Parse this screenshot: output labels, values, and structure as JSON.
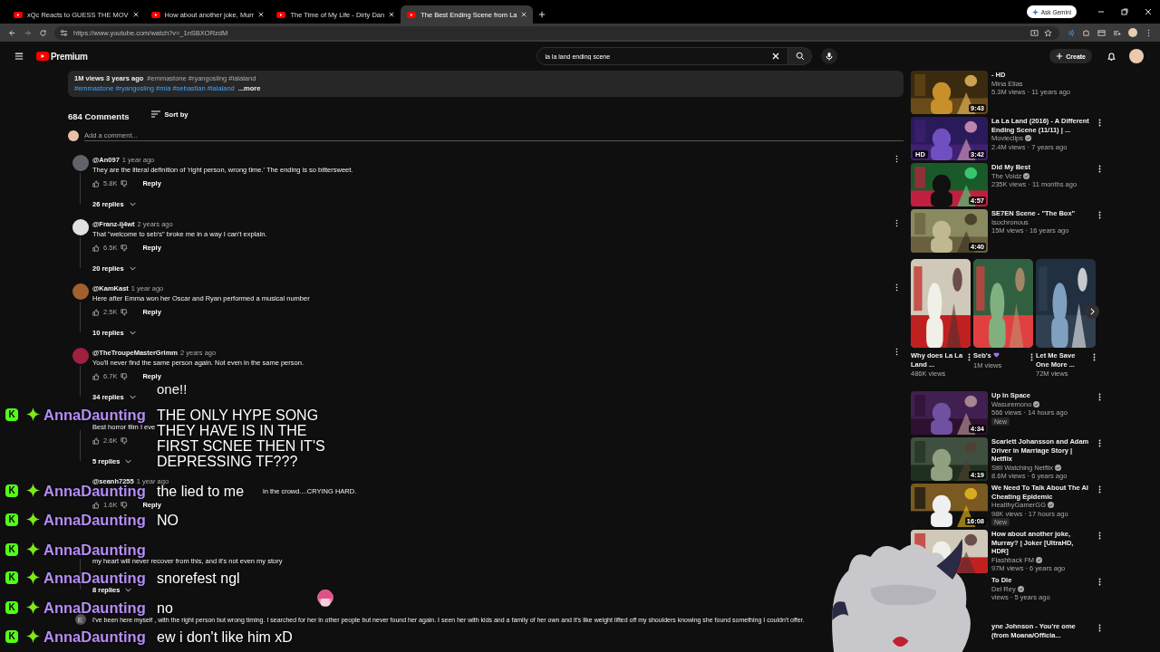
{
  "browser": {
    "tabs": [
      {
        "title": "xQc Reacts to GUESS THE MOV",
        "selected": false
      },
      {
        "title": "How about another joke, Murr",
        "selected": false
      },
      {
        "title": "The Time of My Life - Dirty Dan",
        "selected": false
      },
      {
        "title": "The Best Ending Scene from La",
        "selected": true
      }
    ],
    "ask_button": "Ask Gemini",
    "url": "https://www.youtube.com/watch?v=_1nSBXORzdM"
  },
  "header": {
    "logo": "Premium",
    "search": {
      "value": "la la land ending scene"
    },
    "create": "Create"
  },
  "description": {
    "stats": "1M views  3 years ago",
    "tags_top": "#emmastone #ryangosling #lalaland",
    "tags": "#emmastone #ryangosling #mia #sebastian #lalaland",
    "more": "...more"
  },
  "comments_header": {
    "count": "684 Comments",
    "sort": "Sort by",
    "placeholder": "Add a comment..."
  },
  "comments": [
    {
      "author": "@An097",
      "time": "1 year ago",
      "text": "They are the literal definition of 'right person, wrong time.' The ending is so bittersweet.",
      "likes": "5.8K",
      "reply": "Reply",
      "replies": "26 replies"
    },
    {
      "author": "@Franz-lj4wt",
      "time": "2 years ago",
      "text": "That \"welcome to seb's\" broke me in a way I can't explain.",
      "likes": "6.5K",
      "reply": "Reply",
      "replies": "20 replies"
    },
    {
      "author": "@KamKast",
      "time": "1 year ago",
      "text": "Here after Emma won her Oscar and Ryan performed a musical number",
      "likes": "2.5K",
      "reply": "Reply",
      "replies": "10 replies"
    },
    {
      "author": "@TheTroupeMasterGrimm",
      "time": "2 years ago",
      "text": "You'll never find the same person again. Not even in the same person.",
      "likes": "6.7K",
      "reply": "Reply",
      "replies": "34 replies"
    },
    {
      "text": "Best horror film I eve",
      "likes": "2.6K",
      "replies": "5 replies"
    },
    {
      "author": "@seanh7255",
      "time": "1 year ago",
      "text_tail": "in the crowd....CRYING HARD.",
      "likes": "1.6K",
      "reply": "Reply"
    },
    {
      "text": "my heart will never recover from this, and it's not even my story",
      "replies": "8 replies"
    },
    {
      "avatar_letter": "E",
      "text": "I've been here myself , with the right person but wrong timing. I searched for her in other people but never found her again. I seen her with kids and a family of her own and it's like weight lifted off my shoulders knowing she found something I couldn't offer."
    }
  ],
  "sidebar": [
    {
      "kind": "video",
      "title": "- HD",
      "channel": "Mina Elias",
      "verified": false,
      "meta": "5.3M views · 11 years ago",
      "duration": "9:43"
    },
    {
      "kind": "video",
      "title": "La La Land (2016) - A Different Ending Scene (11/11) | ...",
      "channel": "Movieclips",
      "verified": true,
      "meta": "2.4M views · 7 years ago",
      "duration": "3:42",
      "hd": "HD"
    },
    {
      "kind": "video",
      "title": "Did My Best",
      "channel": "The Voidz",
      "verified": true,
      "meta": "235K views · 11 months ago",
      "duration": "4:57"
    },
    {
      "kind": "video",
      "title": "SE7EN Scene - \"The Box\"",
      "channel": "Isochronous",
      "verified": false,
      "meta": "15M views · 16 years ago",
      "duration": "4:40"
    },
    {
      "kind": "shorts",
      "items": [
        {
          "title": "Why does La La Land ...",
          "views": "486K views",
          "heart": false
        },
        {
          "title": "Seb's",
          "views": "1M views",
          "heart": true
        },
        {
          "title": "Let Me Save One More ...",
          "views": "72M views",
          "heart": false
        }
      ]
    },
    {
      "kind": "video",
      "title": "Up In Space",
      "channel": "Wasuremono",
      "verified": true,
      "meta": "566 views · 14 hours ago",
      "duration": "4:34",
      "badge": "New"
    },
    {
      "kind": "video",
      "title": "Scarlett Johansson and Adam Driver in Marriage Story | Netflix",
      "channel": "Still Watching Netflix",
      "verified": true,
      "meta": "8.6M views · 6 years ago",
      "duration": "4:19"
    },
    {
      "kind": "video",
      "title": "We Need To Talk About The AI Cheating Epidemic",
      "channel": "HealthyGamerGG",
      "verified": true,
      "meta": "98K views · 17 hours ago",
      "duration": "16:08",
      "badge": "New"
    },
    {
      "kind": "video",
      "title": "How about another joke, Murray? | Joker [UltraHD, HDR]",
      "channel": "Flashback FM",
      "verified": true,
      "meta": "97M views · 6 years ago"
    },
    {
      "kind": "video",
      "title": "To Die",
      "channel": "Del Rey",
      "verified": true,
      "meta": "views · 5 years ago"
    },
    {
      "kind": "video",
      "title": "yne Johnson - You're ome (from Moana/Officia..."
    }
  ],
  "chat": {
    "fragment": "one!!",
    "messages": [
      {
        "badge": "K",
        "user": "AnnaDaunting",
        "text": "THE ONLY HYPE SONG THEY HAVE IS IN THE FIRST SCNEE THEN IT'S DEPRESSING TF???"
      },
      {
        "badge": "K",
        "user": "AnnaDaunting",
        "text": "the lied to me"
      },
      {
        "badge": "K",
        "user": "AnnaDaunting",
        "text": "NO"
      },
      {
        "badge": "K",
        "user": "AnnaDaunting"
      },
      {
        "badge": "K",
        "user": "AnnaDaunting",
        "text": "snorefest ngl"
      },
      {
        "badge": "K",
        "user": "AnnaDaunting",
        "text": "no"
      },
      {
        "badge": "K",
        "user": "AnnaDaunting",
        "text": "ew i don't like him xD"
      }
    ]
  }
}
